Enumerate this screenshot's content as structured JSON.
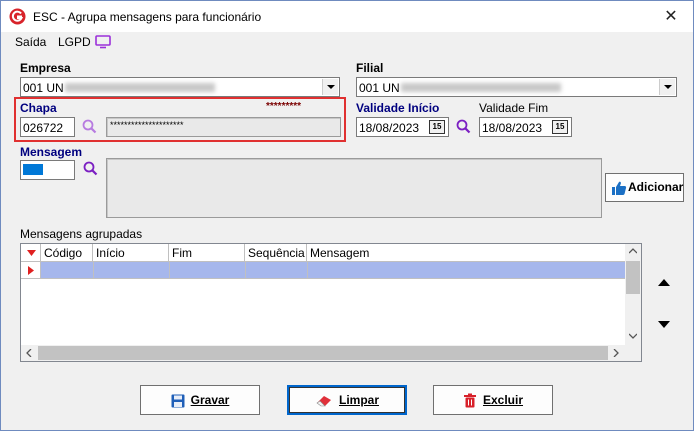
{
  "window": {
    "title": "ESC - Agrupa mensagens para funcionário"
  },
  "menu": {
    "items": [
      "Saída",
      "LGPD"
    ]
  },
  "empresa": {
    "label": "Empresa",
    "value": "001 UN"
  },
  "filial": {
    "label": "Filial",
    "value": "001 UN"
  },
  "chapa": {
    "label": "Chapa",
    "masked": "*********",
    "value": "026722",
    "name_masked": "*********************"
  },
  "validade_inicio": {
    "label": "Validade Início",
    "value": "18/08/2023",
    "calendar": "15"
  },
  "validade_fim": {
    "label": "Validade Fim",
    "value": "18/08/2023",
    "calendar": "15"
  },
  "mensagem": {
    "label": "Mensagem"
  },
  "adicionar": {
    "label": "Adicionar"
  },
  "grid": {
    "title": "Mensagens agrupadas",
    "columns": [
      "Código",
      "Início",
      "Fim",
      "Sequência",
      "Mensagem"
    ]
  },
  "buttons": {
    "gravar": "Gravar",
    "limpar": "Limpar",
    "excluir": "Excluir"
  },
  "colors": {
    "highlight_border": "#e03030",
    "selected_row": "#a6b7ec",
    "label_blue": "#00007f"
  }
}
